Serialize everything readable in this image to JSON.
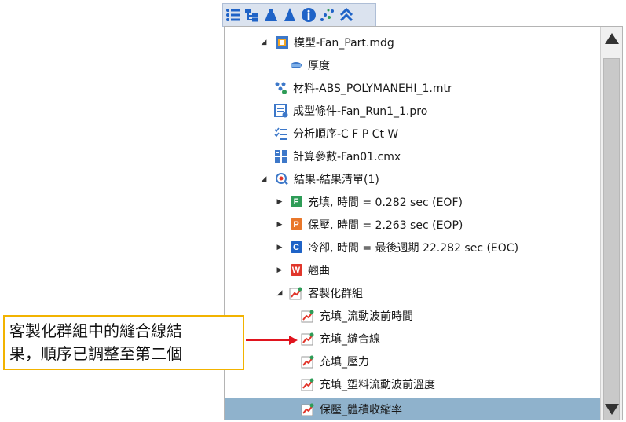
{
  "colors": {
    "selection": "#8fb2cc",
    "badge_fill": "#2e9c57",
    "badge_pack": "#e9772a",
    "badge_cool": "#1f63c7",
    "badge_warp": "#e1362b",
    "callout_border": "#f2b300",
    "arrow": "#e0141e"
  },
  "toolbar": {
    "icons": [
      "list-icon",
      "tree-icon",
      "mold-icon",
      "cone-icon",
      "info-icon",
      "scatter-icon",
      "collapse-up-icon"
    ]
  },
  "tree": {
    "items": [
      {
        "label": "模型-Fan_Part.mdg",
        "icon": "model-icon",
        "expanded": true
      },
      {
        "label": "厚度",
        "icon": "thickness-icon"
      },
      {
        "label": "材料-ABS_POLYMANEHI_1.mtr",
        "icon": "material-icon"
      },
      {
        "label": "成型條件-Fan_Run1_1.pro",
        "icon": "process-icon"
      },
      {
        "label": "分析順序-C F P Ct W",
        "icon": "sequence-icon"
      },
      {
        "label": "計算參數-Fan01.cmx",
        "icon": "calculator-icon"
      },
      {
        "label": "結果-結果清單(1)",
        "icon": "result-icon",
        "expanded": true
      },
      {
        "label": "充填, 時間 = 0.282 sec (EOF)",
        "badge": "F"
      },
      {
        "label": "保壓, 時間 = 2.263 sec (EOP)",
        "badge": "P"
      },
      {
        "label": "冷卻, 時間 = 最後週期 22.282 sec (EOC)",
        "badge": "C"
      },
      {
        "label": "翹曲",
        "badge": "W"
      },
      {
        "label": "客製化群組",
        "icon": "custom-group-icon",
        "expanded": true
      },
      {
        "label": "充填_流動波前時間",
        "icon": "chart-result-icon"
      },
      {
        "label": "充填_縫合線",
        "icon": "chart-result-icon"
      },
      {
        "label": "充填_壓力",
        "icon": "chart-result-icon"
      },
      {
        "label": "充填_塑料流動波前溫度",
        "icon": "chart-result-icon"
      },
      {
        "label": "保壓_體積收縮率",
        "icon": "chart-result-icon",
        "selected": true
      }
    ]
  },
  "callout": {
    "line1": "客製化群組中的縫合線結",
    "line2": "果，順序已調整至第二個"
  }
}
